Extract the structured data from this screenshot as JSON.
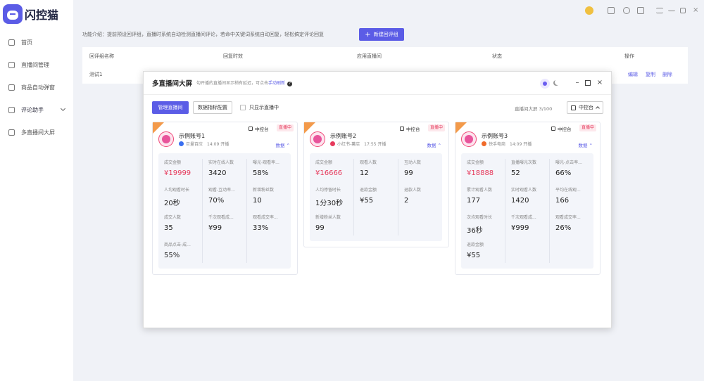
{
  "app": {
    "name": "闪控猫"
  },
  "sidebar": {
    "items": [
      {
        "label": "首页"
      },
      {
        "label": "直播间管理"
      },
      {
        "label": "商品自动弹窗"
      },
      {
        "label": "评论助手"
      },
      {
        "label": "多直播间大屏"
      }
    ]
  },
  "main": {
    "intro": "功能介绍：提前预设回评组，直播时系统自动检测直播间评论，若命中关键词系统自动回复，轻松搞定评论回复",
    "new_button": "新建回评组",
    "table": {
      "headers": [
        "回评组名称",
        "回复时效",
        "应用直播间",
        "状态",
        "操作"
      ],
      "rows": [
        {
          "name": "测试1"
        }
      ],
      "ops": [
        "编辑",
        "复制",
        "删除"
      ]
    }
  },
  "overlay": {
    "title": "多直播间大屏",
    "subtitle": "勾开播的直播间显示稍有延迟，可点击",
    "refresh_link": "手动刷新",
    "manage_button": "管理直播间",
    "config_button": "数据指标配置",
    "only_live_label": "只显示直播中",
    "count": "直播间大屏  3/100",
    "console_button": "中控台",
    "cards": [
      {
        "name": "示例账号1",
        "platform": "巨量百应",
        "platform_color": "#3a6ff0",
        "time": "14:09 开播",
        "console_tag": "中控台",
        "live_tag": "直播中",
        "data_toggle": "数据",
        "metrics": [
          {
            "label": "成交金额",
            "value": "¥19999",
            "highlight": true
          },
          {
            "label": "实时在线人数",
            "value": "3420"
          },
          {
            "label": "曝光-观看率...",
            "value": "58%"
          },
          {
            "label": "人均观看时长",
            "value": "20秒"
          },
          {
            "label": "观看-互动率...",
            "value": "70%"
          },
          {
            "label": "新增粉丝数",
            "value": "10"
          },
          {
            "label": "成交人数",
            "value": "35"
          },
          {
            "label": "千次观看成...",
            "value": "¥99"
          },
          {
            "label": "观看成交率...",
            "value": "33%"
          },
          {
            "label": "商品点击-成...",
            "value": "55%"
          }
        ]
      },
      {
        "name": "示例账号2",
        "platform": "小红书-薯店",
        "platform_color": "#e63a5c",
        "time": "17:55 开播",
        "console_tag": "中控台",
        "live_tag": "直播中",
        "data_toggle": "数据",
        "metrics": [
          {
            "label": "成交金额",
            "value": "¥16666",
            "highlight": true
          },
          {
            "label": "观看人数",
            "value": "12"
          },
          {
            "label": "互动人数",
            "value": "99"
          },
          {
            "label": "人均停留时长",
            "value": "1分30秒"
          },
          {
            "label": "退款金额",
            "value": "¥55"
          },
          {
            "label": "退款人数",
            "value": "2"
          },
          {
            "label": "新增粉丝人数",
            "value": "99"
          }
        ]
      },
      {
        "name": "示例账号3",
        "platform": "快手电商",
        "platform_color": "#f06a2a",
        "time": "14:09 开播",
        "console_tag": "中控台",
        "live_tag": "直播中",
        "data_toggle": "数据",
        "metrics": [
          {
            "label": "成交金额",
            "value": "¥18888",
            "highlight": true
          },
          {
            "label": "直播曝光次数",
            "value": "52"
          },
          {
            "label": "曝光-点击率...",
            "value": "66%"
          },
          {
            "label": "累计观看人数",
            "value": "177"
          },
          {
            "label": "实时观看人数",
            "value": "1420"
          },
          {
            "label": "平均在线观...",
            "value": "166"
          },
          {
            "label": "次均观看时长",
            "value": "36秒"
          },
          {
            "label": "千次观看成...",
            "value": "¥999"
          },
          {
            "label": "观看成交率...",
            "value": "26%"
          },
          {
            "label": "退款金额",
            "value": "¥55"
          }
        ]
      }
    ]
  }
}
